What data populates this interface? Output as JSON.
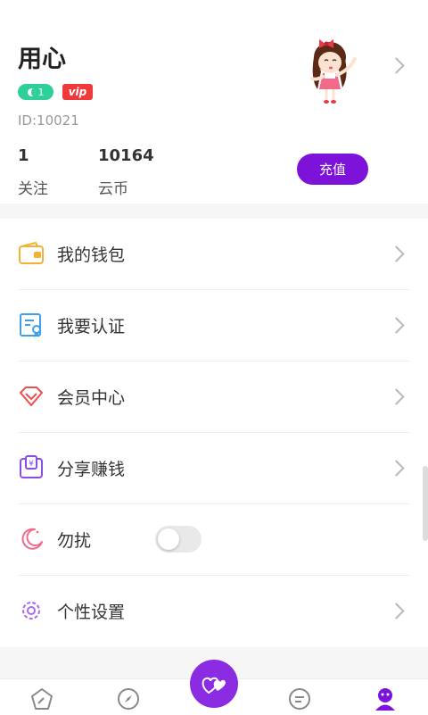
{
  "profile": {
    "name": "用心",
    "level": "1",
    "vip": "vip",
    "id_text": "ID:10021",
    "stats": [
      {
        "value": "1",
        "label": "关注"
      },
      {
        "value": "10164",
        "label": "云币"
      }
    ],
    "recharge_label": "充值"
  },
  "menu": {
    "items": [
      {
        "label": "我的钱包",
        "icon": "wallet-icon"
      },
      {
        "label": "我要认证",
        "icon": "certification-icon"
      },
      {
        "label": "会员中心",
        "icon": "diamond-icon"
      },
      {
        "label": "分享赚钱",
        "icon": "share-earn-icon"
      },
      {
        "label": "勿扰",
        "icon": "moon-icon",
        "toggle": false
      },
      {
        "label": "个性设置",
        "icon": "gear-icon"
      }
    ]
  },
  "tabbar": {
    "items": [
      {
        "icon": "home-pentagon-icon"
      },
      {
        "icon": "compass-icon"
      },
      {
        "icon": "hearts-icon",
        "active_center": true
      },
      {
        "icon": "chat-icon"
      },
      {
        "icon": "profile-icon",
        "active": true
      }
    ]
  },
  "colors": {
    "accent": "#7d12d9",
    "level_badge": "#2fcf9a",
    "vip_badge": "#ee3a3a"
  }
}
